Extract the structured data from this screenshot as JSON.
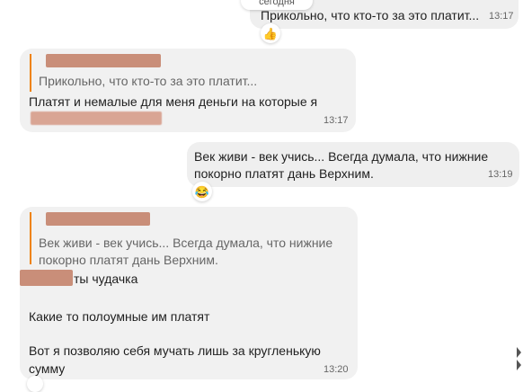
{
  "date_label": "сегодня",
  "messages": [
    {
      "text": "Прикольно, что кто-то за это платит...",
      "time": "13:17",
      "reaction_icon": "👍"
    },
    {
      "quote": "Прикольно, что кто-то за это платит...",
      "line1": "Платят и немалые для меня деньги на которые я",
      "time": "13:17"
    },
    {
      "line1": "Век живи - век учись... Всегда думала, что нижние",
      "line2": "покорно платят дань Верхним.",
      "time": "13:19",
      "reaction_icon": "😂"
    },
    {
      "quote_line1": "Век живи - век учись... Всегда думала, что нижние",
      "quote_line2": "покорно платят дань Верхним.",
      "line1_suffix": "ты чудачка",
      "line2": "Какие то полоумные им платят",
      "line3": "Вот я позволяю себя мучать лишь за кругленькую",
      "line4": "сумму",
      "time": "13:20"
    }
  ],
  "colors": {
    "quote_accent": "#ee8208",
    "redaction": "#c98e79"
  }
}
